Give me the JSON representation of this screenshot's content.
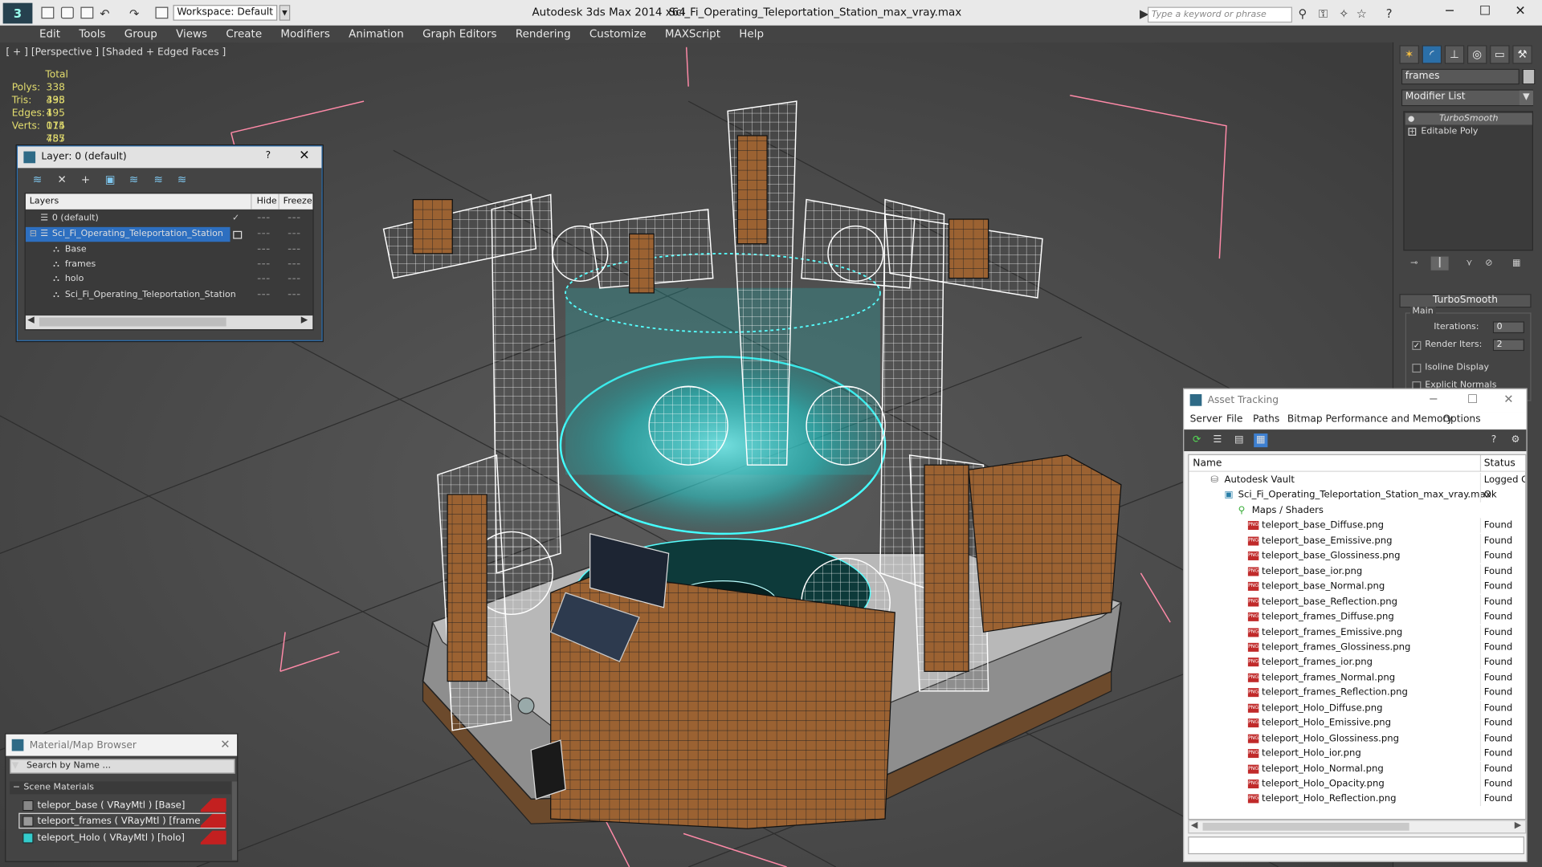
{
  "titlebar": {
    "workspace": "Workspace: Default",
    "app_name": "Autodesk 3ds Max  2014 x64",
    "file_name": "Sci_Fi_Operating_Teleportation_Station_max_vray.max",
    "search_placeholder": "Type a keyword or phrase"
  },
  "menu": [
    "Edit",
    "Tools",
    "Group",
    "Views",
    "Create",
    "Modifiers",
    "Animation",
    "Graph Editors",
    "Rendering",
    "Customize",
    "MAXScript",
    "Help"
  ],
  "viewport": {
    "label": "[ + ] [Perspective ] [Shaded + Edged Faces ]",
    "stats_header": "Total",
    "stats": [
      {
        "key": "Polys:",
        "value": "338 495"
      },
      {
        "key": "Tris:",
        "value": "338 495"
      },
      {
        "key": "Edges:",
        "value": "1 015 485"
      },
      {
        "key": "Verts:",
        "value": "174 757"
      }
    ],
    "hologram_color": "#2ee6e6",
    "wire_color": "#ffffff",
    "wood_color": "#a86a3a"
  },
  "layer_dialog": {
    "title": "Layer: 0 (default)",
    "help": "?",
    "col_layers": "Layers",
    "col_hide": "Hide",
    "col_freeze": "Freeze",
    "rows": [
      {
        "name": "0 (default)",
        "indent": 0
      },
      {
        "name": "Sci_Fi_Operating_Teleportation_Station",
        "indent": 0
      },
      {
        "name": "Base",
        "indent": 1
      },
      {
        "name": "frames",
        "indent": 1
      },
      {
        "name": "holo",
        "indent": 1
      },
      {
        "name": "Sci_Fi_Operating_Teleportation_Station",
        "indent": 1
      }
    ]
  },
  "command_panel": {
    "object_name": "frames",
    "modifier_list": "Modifier List",
    "stack": [
      "TurboSmooth",
      "Editable Poly"
    ],
    "rollout_title": "TurboSmooth",
    "group_main": "Main",
    "iterations_label": "Iterations:",
    "iterations_value": "0",
    "render_iters_label": "Render Iters:",
    "render_iters_value": "2",
    "isoline_label": "Isoline Display",
    "explicit_normals_label": "Explicit Normals"
  },
  "asset_tracking": {
    "title": "Asset Tracking",
    "menu": [
      "Server",
      "File",
      "Paths",
      "Bitmap Performance and Memory",
      "Options"
    ],
    "col_name": "Name",
    "col_status": "Status",
    "rows": [
      {
        "name": "Autodesk Vault",
        "status": "Logged Ou",
        "level": 0,
        "kind": "vault"
      },
      {
        "name": "Sci_Fi_Operating_Teleportation_Station_max_vray.max",
        "status": "Ok",
        "level": 1,
        "kind": "max"
      },
      {
        "name": "Maps / Shaders",
        "status": "",
        "level": 2,
        "kind": "folder"
      },
      {
        "name": "teleport_base_Diffuse.png",
        "status": "Found",
        "level": 3,
        "kind": "png"
      },
      {
        "name": "teleport_base_Emissive.png",
        "status": "Found",
        "level": 3,
        "kind": "png"
      },
      {
        "name": "teleport_base_Glossiness.png",
        "status": "Found",
        "level": 3,
        "kind": "png"
      },
      {
        "name": "teleport_base_ior.png",
        "status": "Found",
        "level": 3,
        "kind": "png"
      },
      {
        "name": "teleport_base_Normal.png",
        "status": "Found",
        "level": 3,
        "kind": "png"
      },
      {
        "name": "teleport_base_Reflection.png",
        "status": "Found",
        "level": 3,
        "kind": "png"
      },
      {
        "name": "teleport_frames_Diffuse.png",
        "status": "Found",
        "level": 3,
        "kind": "png"
      },
      {
        "name": "teleport_frames_Emissive.png",
        "status": "Found",
        "level": 3,
        "kind": "png"
      },
      {
        "name": "teleport_frames_Glossiness.png",
        "status": "Found",
        "level": 3,
        "kind": "png"
      },
      {
        "name": "teleport_frames_ior.png",
        "status": "Found",
        "level": 3,
        "kind": "png"
      },
      {
        "name": "teleport_frames_Normal.png",
        "status": "Found",
        "level": 3,
        "kind": "png"
      },
      {
        "name": "teleport_frames_Reflection.png",
        "status": "Found",
        "level": 3,
        "kind": "png"
      },
      {
        "name": "teleport_Holo_Diffuse.png",
        "status": "Found",
        "level": 3,
        "kind": "png"
      },
      {
        "name": "teleport_Holo_Emissive.png",
        "status": "Found",
        "level": 3,
        "kind": "png"
      },
      {
        "name": "teleport_Holo_Glossiness.png",
        "status": "Found",
        "level": 3,
        "kind": "png"
      },
      {
        "name": "teleport_Holo_ior.png",
        "status": "Found",
        "level": 3,
        "kind": "png"
      },
      {
        "name": "teleport_Holo_Normal.png",
        "status": "Found",
        "level": 3,
        "kind": "png"
      },
      {
        "name": "teleport_Holo_Opacity.png",
        "status": "Found",
        "level": 3,
        "kind": "png"
      },
      {
        "name": "teleport_Holo_Reflection.png",
        "status": "Found",
        "level": 3,
        "kind": "png"
      }
    ]
  },
  "material_browser": {
    "title": "Material/Map Browser",
    "search_placeholder": "Search by Name ...",
    "section": "Scene Materials",
    "items": [
      "telepor_base  ( VRayMtl ) [Base]",
      "teleport_frames  ( VRayMtl ) [frames]",
      "teleport_Holo  ( VRayMtl ) [holo]"
    ]
  }
}
